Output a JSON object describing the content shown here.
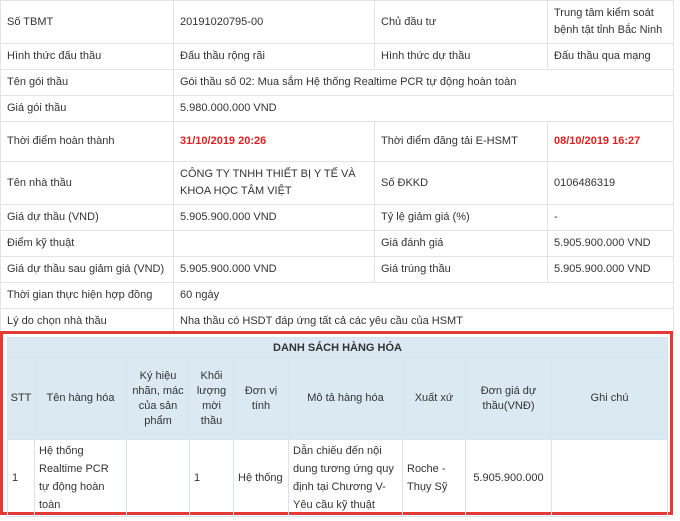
{
  "info": {
    "so_tbmt": {
      "label": "Số TBMT",
      "value": "20191020795-00"
    },
    "chu_dau_tu": {
      "label": "Chủ đầu tư",
      "value": "Trung tâm kiểm soát bệnh tật tỉnh Bắc Ninh"
    },
    "hinh_thuc_dau_thau": {
      "label": "Hình thức đấu thầu",
      "value": "Đấu thầu rộng rãi"
    },
    "hinh_thuc_du_thau": {
      "label": "Hình thức dự thầu",
      "value": "Đấu thầu qua mạng"
    },
    "ten_goi_thau": {
      "label": "Tên gói thầu",
      "value": "Gói thầu số 02: Mua sắm Hệ thống Realtime PCR tự động hoàn toàn"
    },
    "gia_goi_thau": {
      "label": "Giá gói thầu",
      "value": "5.980.000.000 VND"
    },
    "thoi_diem_hoan_thanh": {
      "label": "Thời điểm hoàn thành",
      "value": "31/10/2019 20:26"
    },
    "thoi_diem_dang_tai": {
      "label": "Thời điểm đăng tải E-HSMT",
      "value": "08/10/2019 16:27"
    },
    "ten_nha_thau": {
      "label": "Tên nhà thầu",
      "value": "CÔNG TY TNHH THIẾT BỊ Y TẾ VÀ KHOA HỌC TÂM VIỆT"
    },
    "so_dkkd": {
      "label": "Số ĐKKD",
      "value": "0106486319"
    },
    "gia_du_thau": {
      "label": "Giá dự thầu (VND)",
      "value": "5.905.900.000 VND"
    },
    "ty_le_giam_gia": {
      "label": "Tỷ lệ giảm giá (%)",
      "value": "-"
    },
    "diem_ky_thuat": {
      "label": "Điểm kỹ thuật",
      "value": ""
    },
    "gia_danh_gia": {
      "label": "Giá đánh giá",
      "value": "5.905.900.000 VND"
    },
    "gia_sau_giam": {
      "label": "Giá dự thầu sau giảm giá (VND)",
      "value": "5.905.900.000 VND"
    },
    "gia_trung_thau": {
      "label": "Giá trúng thầu",
      "value": "5.905.900.000 VND"
    },
    "thoi_gian_thuc_hien": {
      "label": "Thời gian thực hiện hợp đồng",
      "value": "60 ngày"
    },
    "ly_do": {
      "label": "Lý do chọn nhà thầu",
      "value": "Nha thầu có HSDT đáp ứng tất cả các yêu cầu của HSMT"
    }
  },
  "goods": {
    "caption": "DANH SÁCH HÀNG HÓA",
    "headers": {
      "stt": "STT",
      "ten_hang_hoa": "Tên hàng hóa",
      "ky_hieu": "Ký hiệu nhãn, mác của sản phẩm",
      "khoi_luong": "Khối lượng mời thầu",
      "don_vi": "Đơn vị tính",
      "mo_ta": "Mô tả hàng hóa",
      "xuat_xu": "Xuất xứ",
      "don_gia": "Đơn giá dự thầu(VNĐ)",
      "ghi_chu": "Ghi chú"
    },
    "rows": [
      {
        "stt": "1",
        "ten_hang_hoa": "Hệ thống Realtime PCR tự động hoàn toàn",
        "ky_hieu": "",
        "khoi_luong": "1",
        "don_vi": "Hệ thống",
        "mo_ta": "Dẫn chiếu đến nội dung tương ứng quy định tại Chương V- Yêu cầu kỹ thuật",
        "xuat_xu": "Roche - Thụy Sỹ",
        "don_gia": "5.905.900.000",
        "ghi_chu": ""
      }
    ]
  },
  "colors": {
    "highlight_border": "#e53935",
    "date_text": "#e02020",
    "header_bg": "#dbe9f3"
  }
}
